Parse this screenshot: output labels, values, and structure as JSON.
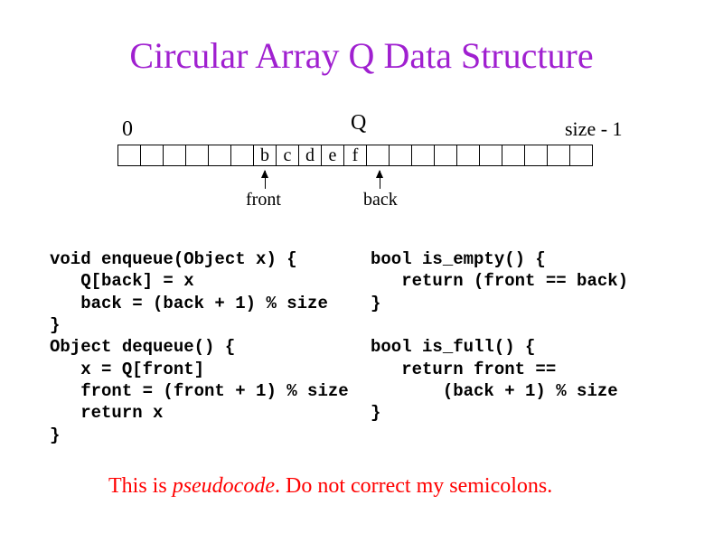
{
  "title": "Circular Array Q Data Structure",
  "array": {
    "name_label": "Q",
    "zero_label": "0",
    "size_label": "size - 1",
    "cells": [
      "",
      "",
      "",
      "",
      "",
      "",
      "b",
      "c",
      "d",
      "e",
      "f",
      "",
      "",
      "",
      "",
      "",
      "",
      "",
      "",
      "",
      ""
    ],
    "front_label": "front",
    "back_label": "back"
  },
  "code_left": "void enqueue(Object x) {\n   Q[back] = x\n   back = (back + 1) % size\n}\nObject dequeue() {\n   x = Q[front]\n   front = (front + 1) % size\n   return x\n}",
  "code_right": "bool is_empty() {\n   return (front == back)\n}\n\nbool is_full() {\n   return front ==\n       (back + 1) % size\n}",
  "footer_pre": "This is ",
  "footer_em": "pseudocode",
  "footer_post": ". Do not correct my semicolons."
}
